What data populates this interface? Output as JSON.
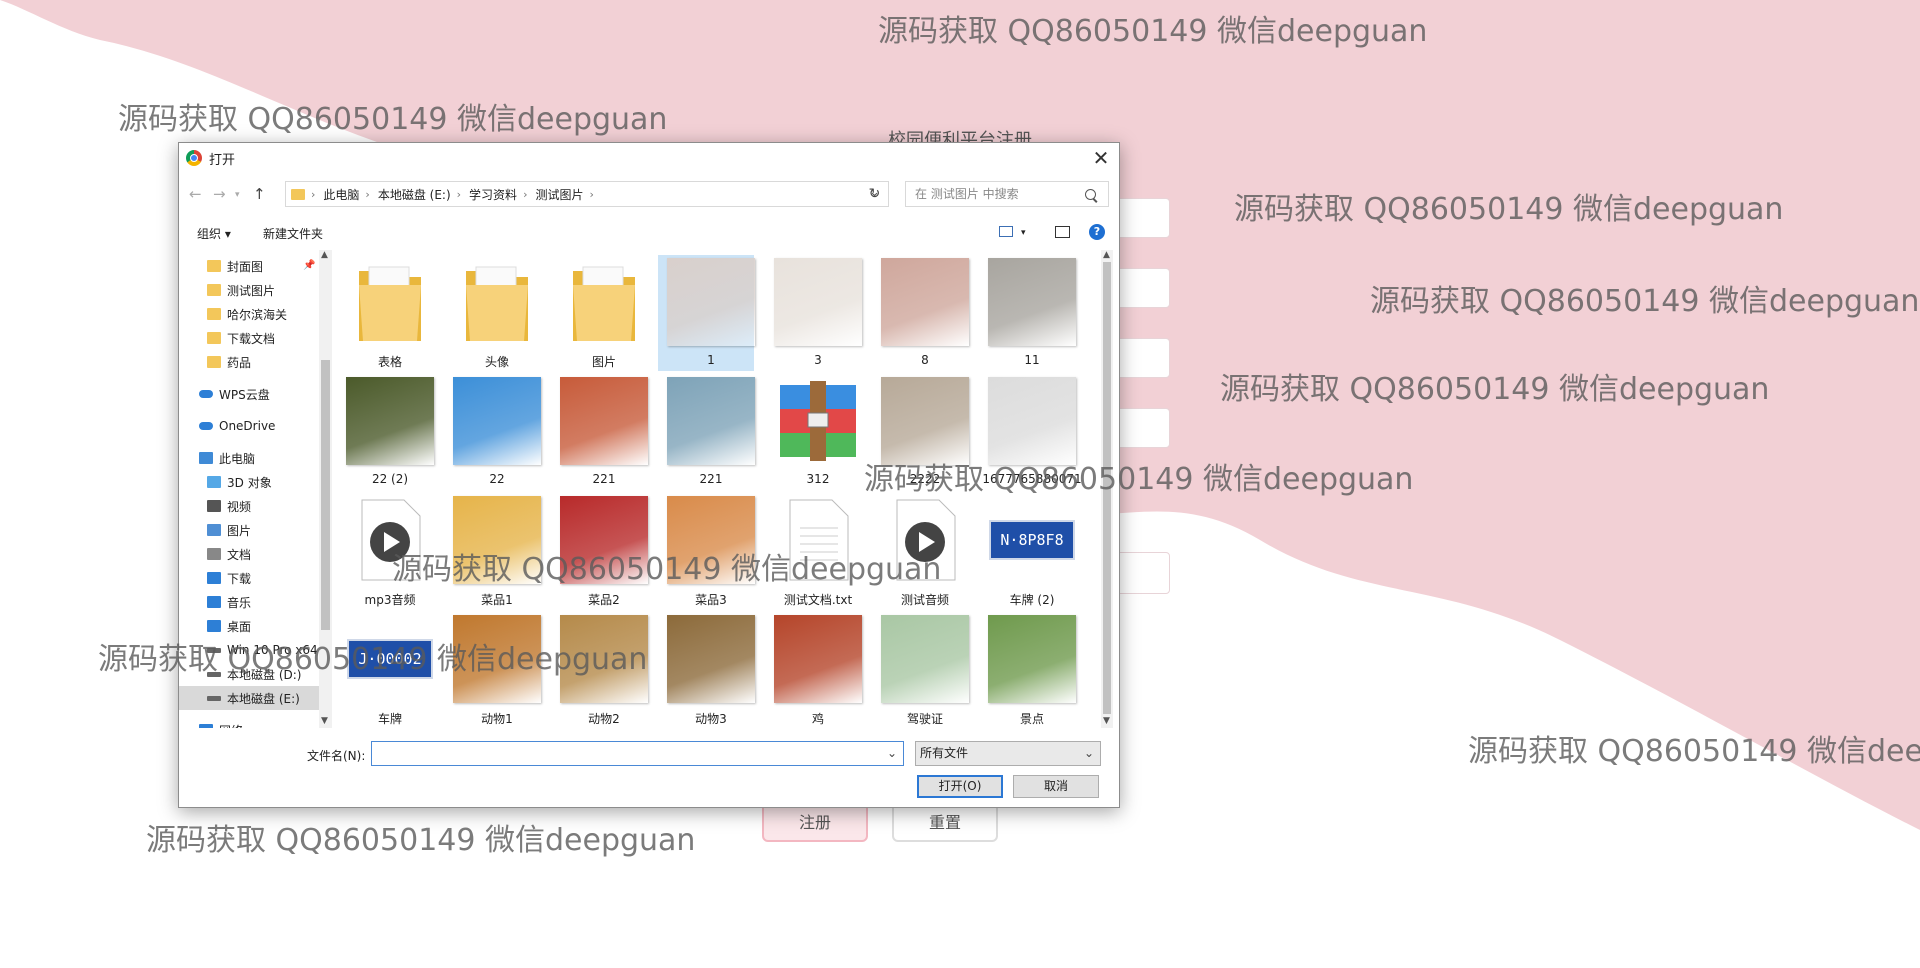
{
  "background": {
    "page_title": "校园便利平台注册",
    "submit_label": "注册",
    "reset_label": "重置"
  },
  "watermarks": [
    "源码获取 QQ86050149 微信deepguan",
    "源码获取 QQ86050149 微信deepguan",
    "源码获取 QQ86050149 微信deepguan",
    "源码获取 QQ86050149 微信deepguan",
    "源码获取 QQ86050149 微信deepguan",
    "源码获取 QQ86050149 微信deepguan",
    "源码获取 QQ86050149 微信deepguan",
    "源码获取 QQ86050149 微信deepguan",
    "源码获取 QQ86050149 微信deep",
    "源码获取 QQ86050149 微信deepguan"
  ],
  "dialog": {
    "title": "打开",
    "breadcrumbs": [
      "此电脑",
      "本地磁盘 (E:)",
      "学习资料",
      "测试图片"
    ],
    "search_placeholder": "在 测试图片 中搜索",
    "toolbar": {
      "organize": "组织 ▾",
      "new_folder": "新建文件夹"
    },
    "nav_items": [
      {
        "label": "封面图",
        "icon": "folder-icon"
      },
      {
        "label": "测试图片",
        "icon": "folder-icon"
      },
      {
        "label": "哈尔滨海关",
        "icon": "folder-icon"
      },
      {
        "label": "下载文档",
        "icon": "folder-icon"
      },
      {
        "label": "药品",
        "icon": "folder-icon"
      },
      {
        "label": "WPS云盘",
        "icon": "cloud-icon"
      },
      {
        "label": "OneDrive",
        "icon": "cloud-icon"
      },
      {
        "label": "此电脑",
        "icon": "computer-icon"
      },
      {
        "label": "3D 对象",
        "icon": "cube-icon"
      },
      {
        "label": "视频",
        "icon": "video-icon"
      },
      {
        "label": "图片",
        "icon": "picture-icon"
      },
      {
        "label": "文档",
        "icon": "document-icon"
      },
      {
        "label": "下载",
        "icon": "download-icon"
      },
      {
        "label": "音乐",
        "icon": "music-icon"
      },
      {
        "label": "桌面",
        "icon": "desktop-icon"
      },
      {
        "label": "Win 10 Pro x64",
        "icon": "drive-icon"
      },
      {
        "label": "本地磁盘 (D:)",
        "icon": "drive-icon"
      },
      {
        "label": "本地磁盘 (E:)",
        "icon": "drive-icon"
      },
      {
        "label": "网络",
        "icon": "network-icon"
      }
    ],
    "files": [
      {
        "name": "表格",
        "kind": "folder"
      },
      {
        "name": "头像",
        "kind": "folder"
      },
      {
        "name": "图片",
        "kind": "folder"
      },
      {
        "name": "1",
        "kind": "photo",
        "color": "#d9d0cc",
        "selected": true
      },
      {
        "name": "3",
        "kind": "photo",
        "color": "#e8e2dc"
      },
      {
        "name": "8",
        "kind": "photo",
        "color": "#cfa79c"
      },
      {
        "name": "11",
        "kind": "photo",
        "color": "#a8a59f"
      },
      {
        "name": "22 (2)",
        "kind": "photo",
        "color": "#4b5a2a"
      },
      {
        "name": "22",
        "kind": "photo",
        "color": "#3c8fd8"
      },
      {
        "name": "221",
        "kind": "photo",
        "color": "#c75b3a"
      },
      {
        "name": "221",
        "kind": "photo",
        "color": "#7ea3b8"
      },
      {
        "name": "312",
        "kind": "archive"
      },
      {
        "name": "2222",
        "kind": "photo",
        "color": "#b7a998"
      },
      {
        "name": "1677765880071",
        "kind": "photo",
        "color": "#dcdcdc"
      },
      {
        "name": "mp3音频",
        "kind": "audio"
      },
      {
        "name": "菜品1",
        "kind": "photo",
        "color": "#e6b44a"
      },
      {
        "name": "菜品2",
        "kind": "photo",
        "color": "#b82a2a"
      },
      {
        "name": "菜品3",
        "kind": "photo",
        "color": "#d98b4a"
      },
      {
        "name": "测试文档.txt",
        "kind": "text"
      },
      {
        "name": "测试音频",
        "kind": "audio"
      },
      {
        "name": "车牌 (2)",
        "kind": "plate",
        "plate_text": "N·8P8F8"
      },
      {
        "name": "车牌",
        "kind": "plate",
        "plate_text": "J·00002"
      },
      {
        "name": "动物1",
        "kind": "photo",
        "color": "#c0782e"
      },
      {
        "name": "动物2",
        "kind": "photo",
        "color": "#b58a4a"
      },
      {
        "name": "动物3",
        "kind": "photo",
        "color": "#8c6a3a"
      },
      {
        "name": "鸡",
        "kind": "photo",
        "color": "#b5452a"
      },
      {
        "name": "驾驶证",
        "kind": "photo",
        "color": "#a9c7a4"
      },
      {
        "name": "景点",
        "kind": "photo",
        "color": "#6f9a4d"
      }
    ],
    "filename_label": "文件名(N):",
    "filename_value": "",
    "filetype_value": "所有文件",
    "open_label": "打开(O)",
    "cancel_label": "取消"
  },
  "colors": {
    "wave": "#f2d0d5",
    "selection": "#cce4f7",
    "accent": "#2c78d4",
    "folder": "#f3c75a"
  }
}
